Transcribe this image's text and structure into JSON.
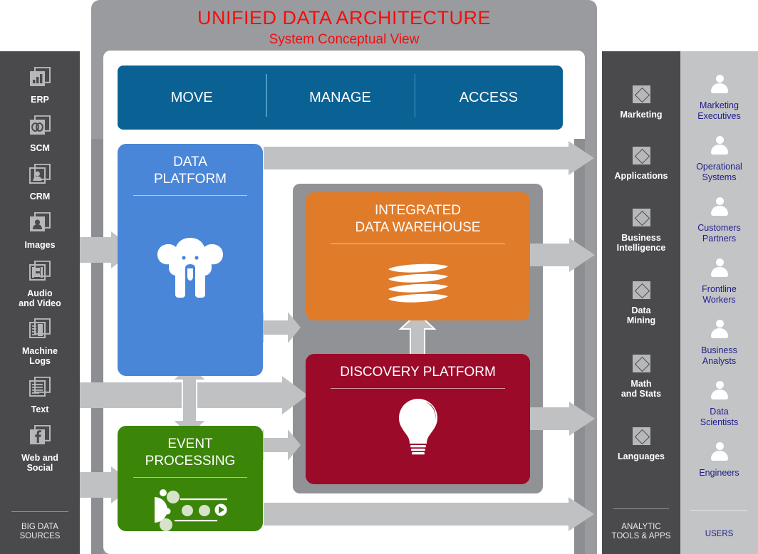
{
  "header": {
    "title": "UNIFIED DATA ARCHITECTURE",
    "subtitle": "System Conceptual View",
    "title_color": "#f40d0d"
  },
  "top_bar": {
    "color": "#0a6193",
    "items": [
      {
        "label": "MOVE"
      },
      {
        "label": "MANAGE"
      },
      {
        "label": "ACCESS"
      }
    ]
  },
  "sources_column": {
    "footer": "BIG DATA\nSOURCES",
    "background": "#4a4a4c",
    "items": [
      {
        "label": "ERP",
        "icon": "chart-document-icon"
      },
      {
        "label": "SCM",
        "icon": "link-document-icon"
      },
      {
        "label": "CRM",
        "icon": "person-document-icon"
      },
      {
        "label": "Images",
        "icon": "image-document-icon"
      },
      {
        "label": "Audio\nand Video",
        "icon": "filmstrip-icon"
      },
      {
        "label": "Machine\nLogs",
        "icon": "log-document-icon"
      },
      {
        "label": "Text",
        "icon": "text-document-icon"
      },
      {
        "label": "Web and\nSocial",
        "icon": "facebook-document-icon"
      }
    ]
  },
  "tools_column": {
    "footer": "ANALYTIC\nTOOLS & APPS",
    "background": "#4a4a4c",
    "items": [
      {
        "label": "Marketing",
        "icon": "diamond-icon"
      },
      {
        "label": "Applications",
        "icon": "diamond-icon"
      },
      {
        "label": "Business\nIntelligence",
        "icon": "diamond-icon"
      },
      {
        "label": "Data\nMining",
        "icon": "diamond-icon"
      },
      {
        "label": "Math\nand Stats",
        "icon": "diamond-icon"
      },
      {
        "label": "Languages",
        "icon": "diamond-icon"
      }
    ]
  },
  "users_column": {
    "footer": "USERS",
    "background": "#c3c4c6",
    "label_color": "#1d1d8c",
    "items": [
      {
        "label": "Marketing\nExecutives",
        "icon": "person-icon"
      },
      {
        "label": "Operational\nSystems",
        "icon": "person-icon"
      },
      {
        "label": "Customers\nPartners",
        "icon": "person-icon"
      },
      {
        "label": "Frontline\nWorkers",
        "icon": "person-icon"
      },
      {
        "label": "Business\nAnalysts",
        "icon": "person-icon"
      },
      {
        "label": "Data\nScientists",
        "icon": "person-icon"
      },
      {
        "label": "Engineers",
        "icon": "person-icon"
      }
    ]
  },
  "blocks": {
    "data_platform": {
      "title": "DATA\nPLATFORM",
      "color": "#4a86d8",
      "icon": "elephant-icon"
    },
    "event_processing": {
      "title": "EVENT\nPROCESSING",
      "color": "#3b8509",
      "icon": "event-stream-icon"
    },
    "integrated_data_warehouse": {
      "title": "INTEGRATED\nDATA WAREHOUSE",
      "color": "#e07b29",
      "icon": "stacked-discs-icon"
    },
    "discovery_platform": {
      "title": "DISCOVERY PLATFORM",
      "color": "#9c0a2a",
      "icon": "lightbulb-icon"
    }
  },
  "arrows": {
    "color": "#c0c1c3",
    "shadow_color": "#8d8e91"
  }
}
